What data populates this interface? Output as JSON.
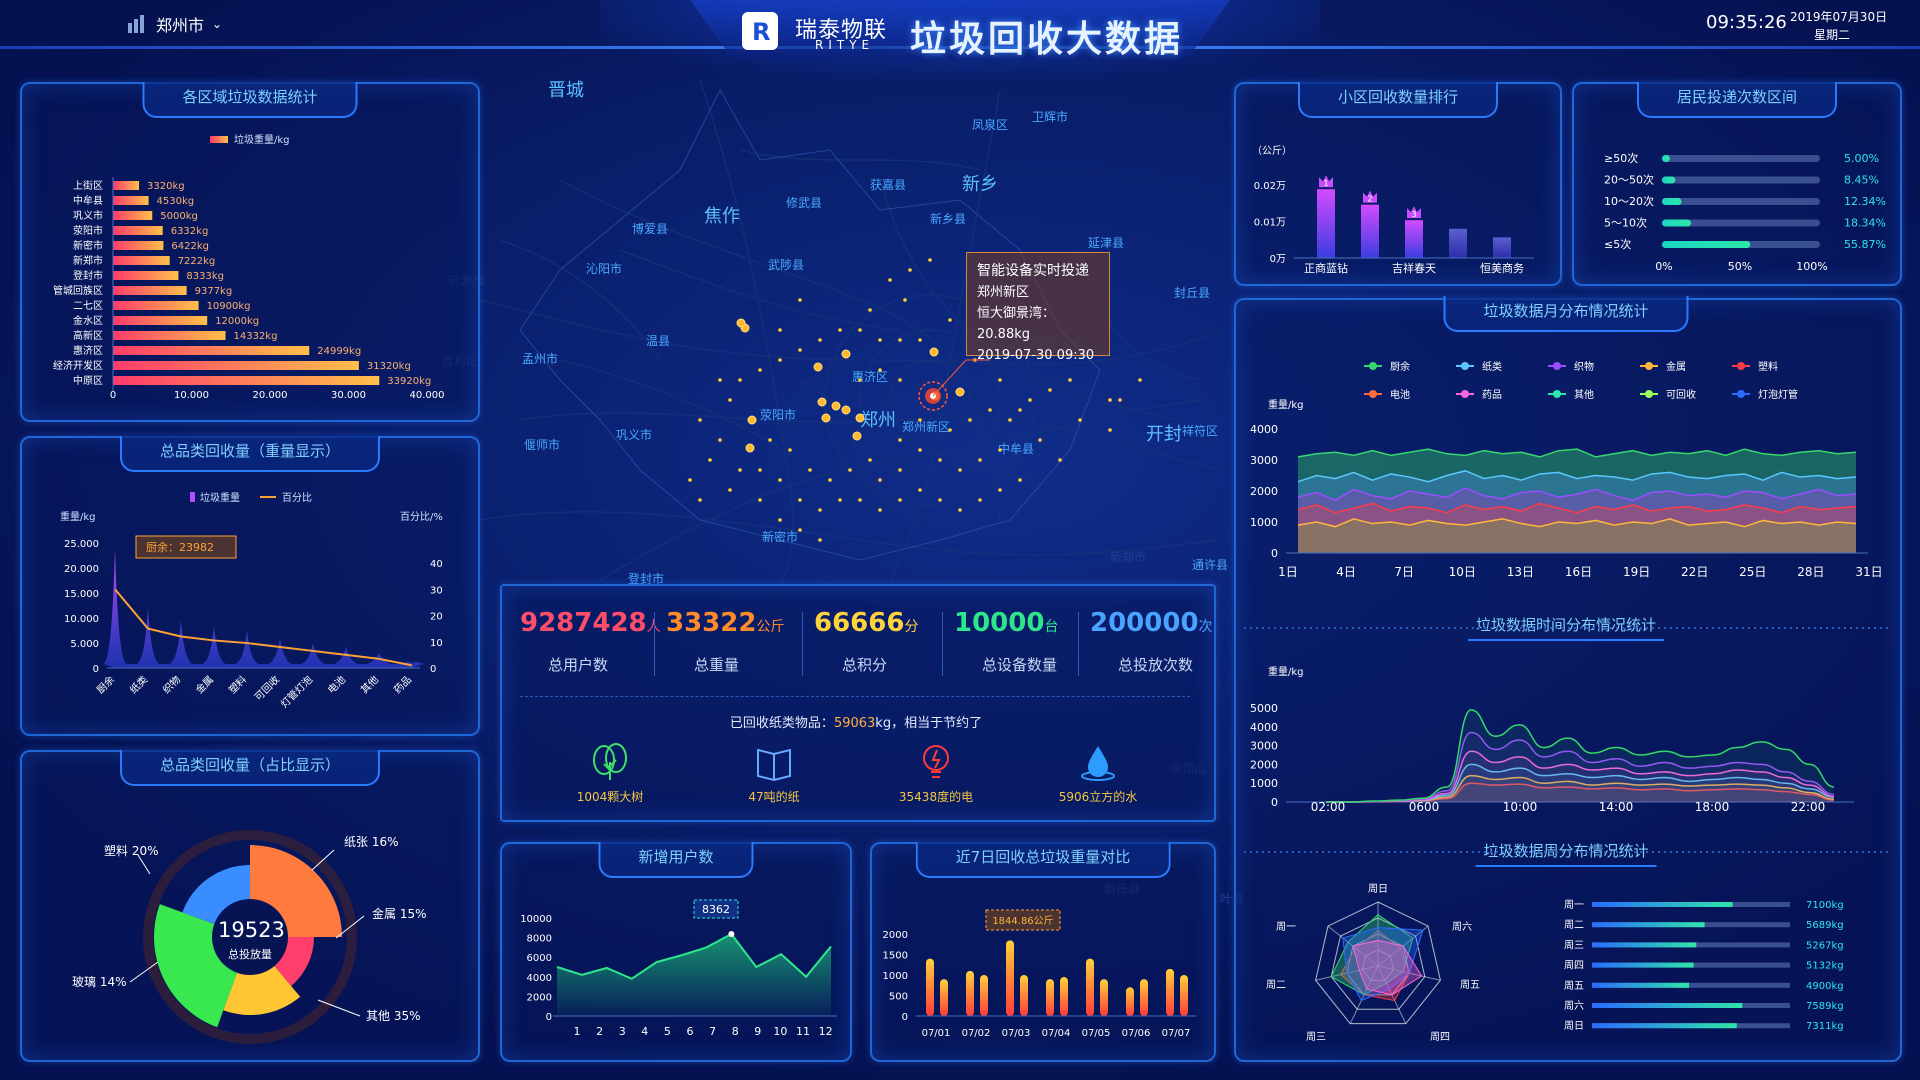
{
  "header": {
    "city": "郑州市",
    "brand_cn": "瑞泰物联",
    "brand_en": "RITYE",
    "title": "垃圾回收大数据",
    "time": "09:35:26",
    "date": "2019年07月30日",
    "weekday": "星期二"
  },
  "map": {
    "labels": [
      {
        "t": "晋城",
        "big": true
      },
      {
        "t": "凤泉区",
        "big": false
      },
      {
        "t": "卫辉市",
        "big": false
      },
      {
        "t": "新乡",
        "big": true
      },
      {
        "t": "焦作",
        "big": true
      },
      {
        "t": "修武县",
        "big": false
      },
      {
        "t": "获嘉县",
        "big": false
      },
      {
        "t": "新乡县",
        "big": false
      },
      {
        "t": "博爱县",
        "big": false
      },
      {
        "t": "延津县",
        "big": false
      },
      {
        "t": "沁阳市",
        "big": false
      },
      {
        "t": "武陟县",
        "big": false
      },
      {
        "t": "封丘县",
        "big": false
      },
      {
        "t": "温县",
        "big": false
      },
      {
        "t": "孟州市",
        "big": false
      },
      {
        "t": "惠济区",
        "big": false
      },
      {
        "t": "荥阳市",
        "big": false
      },
      {
        "t": "郑州",
        "big": true
      },
      {
        "t": "郑州新区",
        "big": false
      },
      {
        "t": "偃师市",
        "big": false
      },
      {
        "t": "巩义市",
        "big": false
      },
      {
        "t": "开封",
        "big": true
      },
      {
        "t": "祥符区",
        "big": false
      },
      {
        "t": "中牟县",
        "big": false
      },
      {
        "t": "新密市",
        "big": false
      },
      {
        "t": "登封市",
        "big": false
      },
      {
        "t": "通许县",
        "big": false
      }
    ],
    "faint_labels": [
      "济源市",
      "吉利区",
      "新郑市",
      "平顶山",
      "尉氏县",
      "叶县"
    ],
    "tooltip": {
      "title": "智能设备实时投递",
      "region": "郑州新区",
      "device_label": "恒大御景湾：",
      "device_value": "20.88kg",
      "time": "2019-07-30 09:30"
    }
  },
  "district_panel": {
    "title": "各区域垃圾数据统计",
    "legend": "垃圾重量/kg",
    "chart_data": {
      "type": "bar",
      "orientation": "horizontal",
      "categories": [
        "上街区",
        "中牟县",
        "巩义市",
        "荥阳市",
        "新密市",
        "新郑市",
        "登封市",
        "管城回族区",
        "二七区",
        "金水区",
        "高新区",
        "惠济区",
        "经济开发区",
        "中原区"
      ],
      "values": [
        3320,
        4530,
        5000,
        6332,
        6422,
        7222,
        8333,
        9377,
        10900,
        12000,
        14332,
        24999,
        31320,
        33920
      ],
      "value_labels": [
        "3320kg",
        "4530kg",
        "5000kg",
        "6332kg",
        "6422kg",
        "7222kg",
        "8333kg",
        "9377kg",
        "10900kg",
        "12000kg",
        "14332kg",
        "24999kg",
        "31320kg",
        "33920kg"
      ],
      "xticks": [
        "0",
        "10.000",
        "20.000",
        "30.000",
        "40.000"
      ],
      "xlim": [
        0,
        40000
      ]
    }
  },
  "category_weight_panel": {
    "title": "总品类回收量（重量显示）",
    "legend": [
      "垃圾重量",
      "百分比"
    ],
    "ylabel_left": "重量/kg",
    "ylabel_right": "百分比/%",
    "callout": "厨余：23982",
    "chart_data": {
      "type": "area",
      "categories": [
        "厨余",
        "纸类",
        "织物",
        "金属",
        "塑料",
        "可回收",
        "灯管灯泡",
        "电池",
        "其他",
        "药品"
      ],
      "weight": [
        23982,
        12000,
        9500,
        8500,
        7500,
        6000,
        5000,
        4200,
        3000,
        1000
      ],
      "percent": [
        30,
        15,
        12,
        10.5,
        9.5,
        8,
        6.5,
        5,
        3.5,
        1
      ],
      "yticks_left": [
        "0",
        "5.000",
        "10.000",
        "15.000",
        "20.000",
        "25.000"
      ],
      "yticks_right": [
        "0",
        "10",
        "20",
        "30",
        "40"
      ],
      "ylim_left": [
        0,
        25000
      ],
      "ylim_right": [
        0,
        40
      ]
    }
  },
  "category_ratio_panel": {
    "title": "总品类回收量（占比显示）",
    "center_value": "19523",
    "center_label": "总投放量",
    "chart_data": {
      "type": "pie",
      "slices": [
        {
          "name": "塑料",
          "value": 20,
          "label": "塑料 20%",
          "color": "#ff7a3d"
        },
        {
          "name": "纸张",
          "value": 16,
          "label": "纸张 16%",
          "color": "#ff3e6c"
        },
        {
          "name": "金属",
          "value": 15,
          "label": "金属 15%",
          "color": "#ffc634"
        },
        {
          "name": "其他",
          "value": 35,
          "label": "其他 35%",
          "color": "#38e84e"
        },
        {
          "name": "玻璃",
          "value": 14,
          "label": "玻璃 14%",
          "color": "#3a8dff"
        }
      ]
    }
  },
  "kpi": {
    "items": [
      {
        "value": "9287428",
        "unit": "人",
        "label": "总用户数",
        "color": "#ff4d6a"
      },
      {
        "value": "33322",
        "unit": "公斤",
        "label": "总重量",
        "color": "#ff8a2a"
      },
      {
        "value": "66666",
        "unit": "分",
        "label": "总积分",
        "color": "#ffd43b"
      },
      {
        "value": "10000",
        "unit": "台",
        "label": "总设备数量",
        "color": "#2ee68a"
      },
      {
        "value": "200000",
        "unit": "次",
        "label": "总投放次数",
        "color": "#4aa3ff"
      }
    ],
    "paper_prefix": "已回收纸类物品：",
    "paper_value": "59063",
    "paper_suffix": "kg，相当于节约了",
    "savings": [
      {
        "value": "1004",
        "unit": "颗大树",
        "icon": "tree-icon"
      },
      {
        "value": "47",
        "unit": "吨的纸",
        "icon": "book-icon"
      },
      {
        "value": "35438",
        "unit": "度的电",
        "icon": "bulb-icon"
      },
      {
        "value": "5906",
        "unit": "立方的水",
        "icon": "water-drop-icon"
      }
    ]
  },
  "new_users_panel": {
    "title": "新增用户数",
    "callout": "8362",
    "chart_data": {
      "type": "area",
      "x": [
        "1",
        "2",
        "3",
        "4",
        "5",
        "6",
        "7",
        "8",
        "9",
        "10",
        "11",
        "12"
      ],
      "values": [
        5000,
        4200,
        4900,
        3800,
        5500,
        6200,
        7000,
        8362,
        5000,
        6300,
        4000,
        7100
      ],
      "yticks": [
        "0",
        "2000",
        "4000",
        "6000",
        "8000",
        "10000"
      ],
      "ylim": [
        0,
        10000
      ]
    }
  },
  "week_weight_panel": {
    "title": "近7日回收总垃圾重量对比",
    "callout": "1844.86公斤",
    "chart_data": {
      "type": "bar",
      "categories": [
        "07/01",
        "07/02",
        "07/03",
        "07/04",
        "07/05",
        "07/06",
        "07/07"
      ],
      "series": [
        {
          "values": [
            1400,
            1100,
            1844.86,
            900,
            1400,
            700,
            1150
          ]
        },
        {
          "values": [
            900,
            1000,
            1000,
            950,
            900,
            900,
            1000
          ]
        }
      ],
      "yticks": [
        "0",
        "500",
        "1000",
        "1500",
        "2000"
      ],
      "ylim": [
        0,
        2000
      ]
    }
  },
  "community_panel": {
    "title": "小区回收数量排行",
    "unit": "（公斤）",
    "chart_data": {
      "type": "bar",
      "categories": [
        "正商蓝钻",
        "",
        "吉祥春天",
        "",
        "恒美商务"
      ],
      "values": [
        200,
        155,
        110,
        85,
        60
      ],
      "ranks": [
        "1",
        "2",
        "3",
        "",
        ""
      ],
      "yticks": [
        "0万",
        "0.01万",
        "0.02万"
      ],
      "ylim": [
        0,
        250
      ]
    }
  },
  "frequency_panel": {
    "title": "居民投递次数区间",
    "chart_data": {
      "type": "bar",
      "orientation": "horizontal",
      "categories": [
        "≥50次",
        "20～50次",
        "10～20次",
        "5～10次",
        "≤5次"
      ],
      "values": [
        5.0,
        8.45,
        12.34,
        18.34,
        55.87
      ],
      "value_labels": [
        "5.00%",
        "8.45%",
        "12.34%",
        "18.34%",
        "55.87%"
      ],
      "xticks": [
        "0%",
        "50%",
        "100%"
      ],
      "xlim": [
        0,
        100
      ]
    }
  },
  "monthly_panel": {
    "title": "垃圾数据月分布情况统计",
    "ylabel": "重量/kg",
    "legend": [
      {
        "name": "厨余",
        "color": "#35d96b"
      },
      {
        "name": "纸类",
        "color": "#5ac8ff"
      },
      {
        "name": "织物",
        "color": "#9b4dff"
      },
      {
        "name": "金属",
        "color": "#ffb73a"
      },
      {
        "name": "塑料",
        "color": "#ff3b47"
      },
      {
        "name": "电池",
        "color": "#ff6a3d"
      },
      {
        "name": "药品",
        "color": "#ff66dd"
      },
      {
        "name": "其他",
        "color": "#2ee6a8"
      },
      {
        "name": "可回收",
        "color": "#9aff5a"
      },
      {
        "name": "灯泡灯管",
        "color": "#2a6bff"
      }
    ],
    "chart_data": {
      "type": "area",
      "x": [
        "1日",
        "4日",
        "7日",
        "10日",
        "13日",
        "16日",
        "19日",
        "22日",
        "25日",
        "28日",
        "31日"
      ],
      "series": [
        {
          "name": "厨余",
          "values": [
            3100,
            3200,
            3250,
            3150,
            3300,
            3150,
            3250,
            3350,
            3200,
            3150,
            3300,
            3200,
            3250,
            3100,
            3300,
            3350,
            3100,
            3200,
            3300,
            3150,
            3250,
            3200,
            3300,
            3150,
            3350,
            3200,
            3150,
            3250,
            3300,
            3200,
            3250
          ]
        },
        {
          "name": "纸类",
          "values": [
            2300,
            2500,
            2400,
            2600,
            2350,
            2550,
            2450,
            2300,
            2500,
            2650,
            2400,
            2500,
            2350,
            2550,
            2600,
            2400,
            2500,
            2450,
            2350,
            2550,
            2600,
            2450,
            2400,
            2500,
            2550,
            2350,
            2600,
            2450,
            2500,
            2400,
            2450
          ]
        },
        {
          "name": "织物",
          "values": [
            1800,
            1950,
            1700,
            2050,
            1850,
            1750,
            2000,
            1900,
            1800,
            2100,
            1850,
            1750,
            1950,
            2000,
            1800,
            1900,
            2050,
            1850,
            1700,
            1950,
            2000,
            1850,
            1900,
            1800,
            2000,
            1950,
            1750,
            1900,
            2050,
            1850,
            1900
          ]
        },
        {
          "name": "塑料",
          "values": [
            1400,
            1550,
            1300,
            1450,
            1600,
            1350,
            1500,
            1450,
            1300,
            1550,
            1400,
            1500,
            1350,
            1600,
            1450,
            1300,
            1500,
            1400,
            1550,
            1350,
            1450,
            1500,
            1350,
            1400,
            1550,
            1450,
            1300,
            1500,
            1400,
            1450,
            1500
          ]
        },
        {
          "name": "金属",
          "values": [
            900,
            1000,
            850,
            1100,
            950,
            1000,
            900,
            1050,
            950,
            900,
            1000,
            1100,
            950,
            850,
            1000,
            950,
            1050,
            900,
            1000,
            950,
            1100,
            900,
            950,
            1000,
            850,
            1050,
            950,
            1000,
            900,
            1000,
            950
          ]
        }
      ],
      "yticks": [
        "0",
        "1000",
        "2000",
        "3000",
        "4000"
      ],
      "ylim": [
        0,
        4000
      ]
    }
  },
  "time_panel": {
    "title": "垃圾数据时间分布情况统计",
    "ylabel": "重量/kg",
    "chart_data": {
      "type": "line",
      "x": [
        "02:00",
        "0600",
        "10:00",
        "14:00",
        "18:00",
        "22:00"
      ],
      "series": [
        {
          "color": "#35d96b",
          "values": [
            0,
            0,
            50,
            100,
            200,
            800,
            4900,
            3500,
            4100,
            2900,
            3400,
            2600,
            2900,
            2500,
            2700,
            2400,
            2500,
            2900,
            3200,
            2800,
            2000,
            800
          ]
        },
        {
          "color": "#9b4dff",
          "values": [
            0,
            0,
            30,
            80,
            150,
            600,
            3700,
            2800,
            3300,
            2400,
            2700,
            2100,
            2300,
            1900,
            2100,
            1800,
            1900,
            2100,
            2000,
            1600,
            1100,
            400
          ]
        },
        {
          "color": "#ff66dd",
          "values": [
            0,
            0,
            20,
            60,
            120,
            450,
            2700,
            2100,
            2400,
            1800,
            2000,
            1700,
            1800,
            1500,
            1600,
            1400,
            1500,
            1700,
            1600,
            1300,
            900,
            300
          ]
        },
        {
          "color": "#5ac8ff",
          "values": [
            0,
            0,
            20,
            50,
            100,
            350,
            2000,
            1600,
            1800,
            1400,
            1500,
            1300,
            1400,
            1200,
            1300,
            1100,
            1200,
            1300,
            1200,
            1000,
            700,
            250
          ]
        },
        {
          "color": "#ffb73a",
          "values": [
            0,
            0,
            10,
            40,
            80,
            250,
            1400,
            1200,
            1300,
            1000,
            1100,
            900,
            1000,
            900,
            950,
            850,
            900,
            950,
            900,
            750,
            500,
            150
          ]
        },
        {
          "color": "#ff3b47",
          "values": [
            0,
            0,
            10,
            30,
            60,
            180,
            1000,
            900,
            950,
            750,
            800,
            700,
            750,
            650,
            700,
            600,
            650,
            700,
            650,
            550,
            400,
            100
          ]
        }
      ],
      "yticks": [
        "0",
        "1000",
        "2000",
        "3000",
        "4000",
        "5000"
      ],
      "ylim": [
        0,
        5000
      ]
    }
  },
  "weekly_panel": {
    "title": "垃圾数据周分布情况统计",
    "radar_labels": [
      "周日",
      "周六",
      "周五",
      "周四",
      "周三",
      "周二",
      "周一"
    ],
    "chart_data": {
      "type": "bar",
      "orientation": "horizontal",
      "categories": [
        "周一",
        "周二",
        "周三",
        "周四",
        "周五",
        "周六",
        "周日"
      ],
      "values": [
        7100,
        5689,
        5267,
        5132,
        4900,
        7589,
        7311
      ],
      "value_labels": [
        "7100kg",
        "5689kg",
        "5267kg",
        "5132kg",
        "4900kg",
        "7589kg",
        "7311kg"
      ],
      "xlim": [
        0,
        10000
      ]
    }
  }
}
